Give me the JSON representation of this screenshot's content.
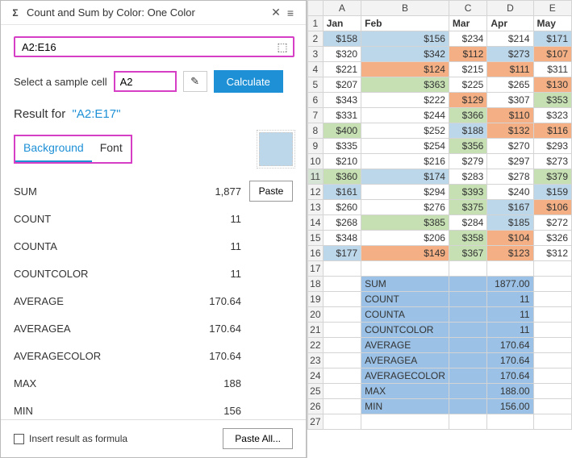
{
  "panel": {
    "title": "Count and Sum by Color: One Color",
    "range_value": "A2:E16",
    "sample_label": "Select a sample cell",
    "sample_value": "A2",
    "calculate_label": "Calculate",
    "result_prefix": "Result for",
    "result_range": "\"A2:E17\"",
    "tabs": {
      "background": "Background",
      "font": "Font"
    },
    "results": [
      {
        "label": "SUM",
        "value": "1,877",
        "paste": true
      },
      {
        "label": "COUNT",
        "value": "11"
      },
      {
        "label": "COUNTA",
        "value": "11"
      },
      {
        "label": "COUNTCOLOR",
        "value": "11"
      },
      {
        "label": "AVERAGE",
        "value": "170.64"
      },
      {
        "label": "AVERAGEA",
        "value": "170.64"
      },
      {
        "label": "AVERAGECOLOR",
        "value": "170.64"
      },
      {
        "label": "MAX",
        "value": "188"
      },
      {
        "label": "MIN",
        "value": "156"
      }
    ],
    "paste_label": "Paste",
    "insert_formula_label": "Insert result as formula",
    "paste_all_label": "Paste All..."
  },
  "sheet": {
    "cols": [
      "A",
      "B",
      "C",
      "D",
      "E"
    ],
    "headers": [
      "Jan",
      "Feb",
      "Mar",
      "Apr",
      "May"
    ],
    "rows": [
      [
        {
          "t": "$158",
          "c": "blue"
        },
        {
          "t": "$156",
          "c": "blue"
        },
        {
          "t": "$234"
        },
        {
          "t": "$214"
        },
        {
          "t": "$171",
          "c": "blue"
        }
      ],
      [
        {
          "t": "$320"
        },
        {
          "t": "$342",
          "c": "blue"
        },
        {
          "t": "$112",
          "c": "orange"
        },
        {
          "t": "$273",
          "c": "blue"
        },
        {
          "t": "$107",
          "c": "orange"
        }
      ],
      [
        {
          "t": "$221"
        },
        {
          "t": "$124",
          "c": "orange"
        },
        {
          "t": "$215"
        },
        {
          "t": "$111",
          "c": "orange"
        },
        {
          "t": "$311"
        }
      ],
      [
        {
          "t": "$207"
        },
        {
          "t": "$363",
          "c": "green"
        },
        {
          "t": "$225"
        },
        {
          "t": "$265"
        },
        {
          "t": "$130",
          "c": "orange"
        }
      ],
      [
        {
          "t": "$343"
        },
        {
          "t": "$222"
        },
        {
          "t": "$129",
          "c": "orange"
        },
        {
          "t": "$307"
        },
        {
          "t": "$353",
          "c": "green"
        }
      ],
      [
        {
          "t": "$331"
        },
        {
          "t": "$244"
        },
        {
          "t": "$366",
          "c": "green"
        },
        {
          "t": "$110",
          "c": "orange"
        },
        {
          "t": "$323"
        }
      ],
      [
        {
          "t": "$400",
          "c": "green"
        },
        {
          "t": "$252"
        },
        {
          "t": "$188",
          "c": "blue"
        },
        {
          "t": "$132",
          "c": "orange"
        },
        {
          "t": "$116",
          "c": "orange"
        }
      ],
      [
        {
          "t": "$335"
        },
        {
          "t": "$254"
        },
        {
          "t": "$356",
          "c": "green"
        },
        {
          "t": "$270"
        },
        {
          "t": "$293"
        }
      ],
      [
        {
          "t": "$210"
        },
        {
          "t": "$216"
        },
        {
          "t": "$279"
        },
        {
          "t": "$297"
        },
        {
          "t": "$273"
        }
      ],
      [
        {
          "t": "$360",
          "c": "green"
        },
        {
          "t": "$174",
          "c": "blue"
        },
        {
          "t": "$283"
        },
        {
          "t": "$278"
        },
        {
          "t": "$379",
          "c": "green"
        }
      ],
      [
        {
          "t": "$161",
          "c": "blue"
        },
        {
          "t": "$294"
        },
        {
          "t": "$393",
          "c": "green"
        },
        {
          "t": "$240"
        },
        {
          "t": "$159",
          "c": "blue"
        }
      ],
      [
        {
          "t": "$260"
        },
        {
          "t": "$276"
        },
        {
          "t": "$375",
          "c": "green"
        },
        {
          "t": "$167",
          "c": "blue"
        },
        {
          "t": "$106",
          "c": "orange"
        }
      ],
      [
        {
          "t": "$268"
        },
        {
          "t": "$385",
          "c": "green"
        },
        {
          "t": "$284"
        },
        {
          "t": "$185",
          "c": "blue"
        },
        {
          "t": "$272"
        }
      ],
      [
        {
          "t": "$348"
        },
        {
          "t": "$206"
        },
        {
          "t": "$358",
          "c": "green"
        },
        {
          "t": "$104",
          "c": "orange"
        },
        {
          "t": "$326"
        }
      ],
      [
        {
          "t": "$177",
          "c": "blue"
        },
        {
          "t": "$149",
          "c": "orange"
        },
        {
          "t": "$367",
          "c": "green"
        },
        {
          "t": "$123",
          "c": "orange"
        },
        {
          "t": "$312"
        }
      ]
    ],
    "summary": [
      {
        "label": "SUM",
        "value": "1877.00"
      },
      {
        "label": "COUNT",
        "value": "11"
      },
      {
        "label": "COUNTA",
        "value": "11"
      },
      {
        "label": "COUNTCOLOR",
        "value": "11"
      },
      {
        "label": "AVERAGE",
        "value": "170.64"
      },
      {
        "label": "AVERAGEA",
        "value": "170.64"
      },
      {
        "label": "AVERAGECOLOR",
        "value": "170.64"
      },
      {
        "label": "MAX",
        "value": "188.00"
      },
      {
        "label": "MIN",
        "value": "156.00"
      }
    ]
  }
}
